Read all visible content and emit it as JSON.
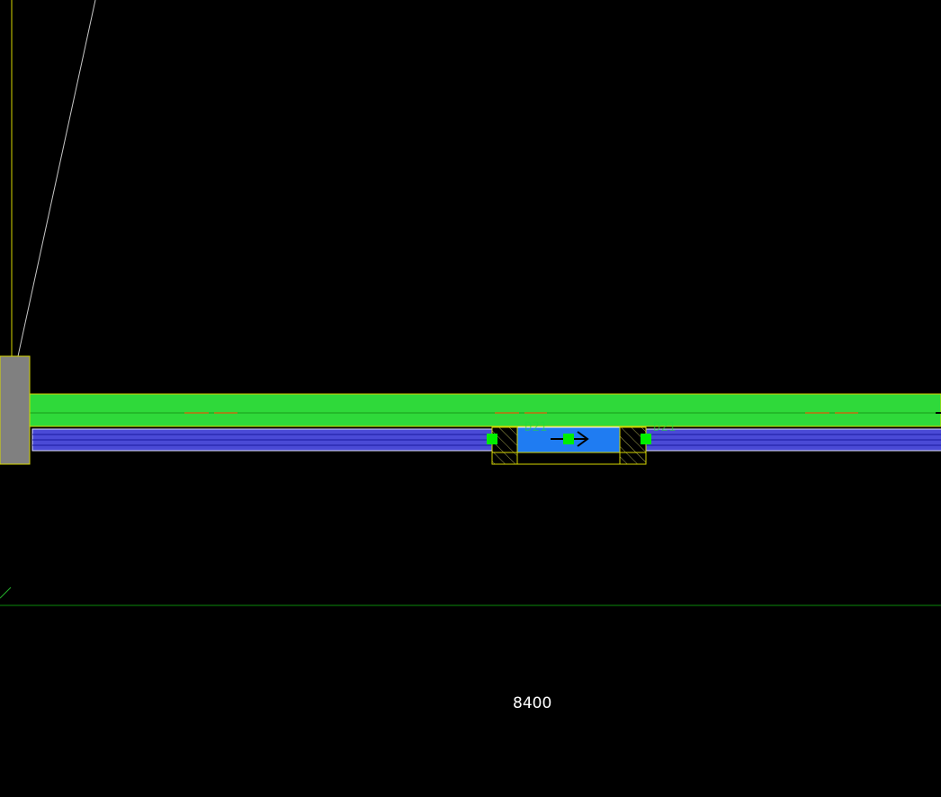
{
  "dimension": {
    "value": "8400"
  },
  "door_tag": {
    "left_text": "D21",
    "right_text": "D21"
  },
  "colors": {
    "background": "#000000",
    "slab_green": "#2fd93a",
    "wall_blue": "#4a4ad6",
    "wall_outline": "#1a1aa0",
    "door_fill": "#1f7cf2",
    "grip_green": "#00ee00",
    "yellow_line": "#d6d600",
    "gray_column": "#808080",
    "hidden_line_orange": "#c46a10",
    "dim_line_green": "#0a8a0a"
  },
  "icons": {
    "door_direction": "arrow-right-icon"
  }
}
